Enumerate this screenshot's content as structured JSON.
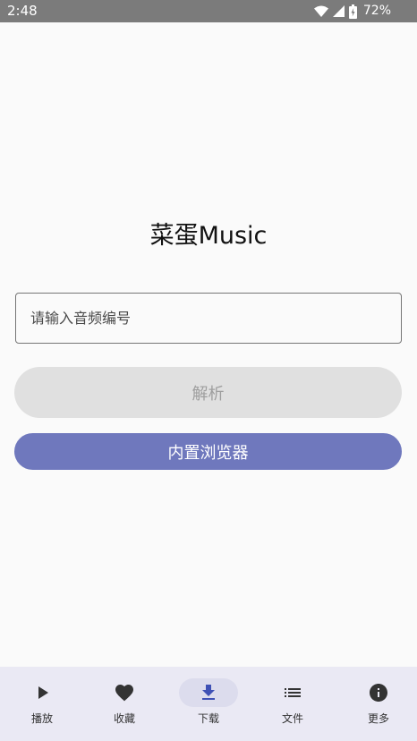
{
  "status_bar": {
    "time": "2:48",
    "battery": "72%",
    "icons": [
      "wifi-icon",
      "signal-icon",
      "battery-charging-icon"
    ]
  },
  "main": {
    "title": "菜蛋Music",
    "input_placeholder": "请输入音频编号",
    "input_value": "",
    "parse_label": "解析",
    "browser_label": "内置浏览器"
  },
  "nav": {
    "active": "download",
    "items": [
      {
        "id": "play",
        "label": "播放",
        "icon": "play-icon"
      },
      {
        "id": "favorites",
        "label": "收藏",
        "icon": "heart-icon"
      },
      {
        "id": "download",
        "label": "下载",
        "icon": "download-icon"
      },
      {
        "id": "files",
        "label": "文件",
        "icon": "list-icon"
      },
      {
        "id": "more",
        "label": "更多",
        "icon": "info-icon"
      }
    ]
  },
  "colors": {
    "status_bar": "#7b7b7b",
    "primary": "#6f78bd",
    "nav_background": "#eae9f4",
    "nav_active_pill": "#dcdced",
    "active_icon": "#3f51b5",
    "disabled_button": "#e0e0e0"
  }
}
